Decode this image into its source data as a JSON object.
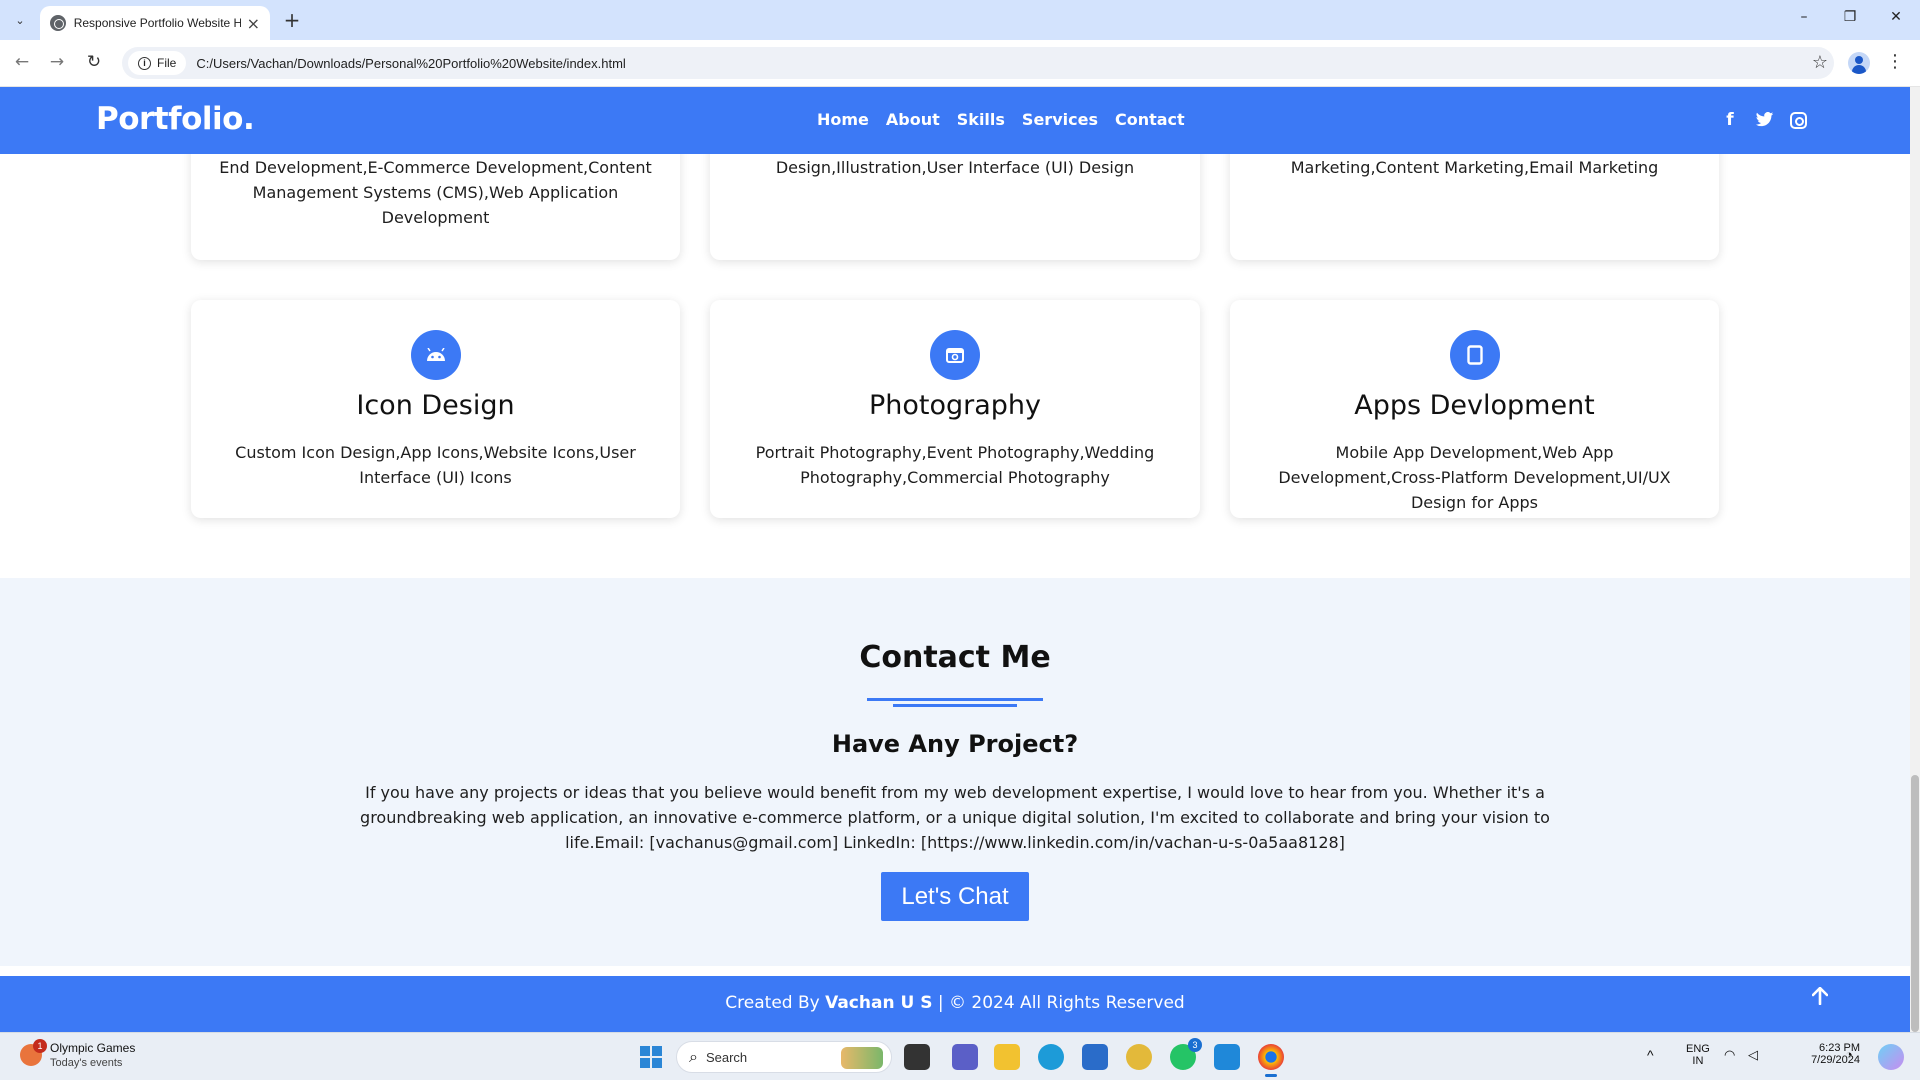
{
  "browser": {
    "tab_title": "Responsive Portfolio Website H",
    "file_label": "File",
    "url": "C:/Users/Vachan/Downloads/Personal%20Portfolio%20Website/index.html"
  },
  "site": {
    "logo": "Portfolio.",
    "nav": [
      "Home",
      "About",
      "Skills",
      "Services",
      "Contact"
    ],
    "social_icons": [
      "facebook-icon",
      "twitter-icon",
      "instagram-icon"
    ]
  },
  "services": {
    "top_row": [
      {
        "desc": "End Development,E-Commerce Development,Content Management Systems (CMS),Web Application Development"
      },
      {
        "desc": "Design,Illustration,User Interface (UI) Design"
      },
      {
        "desc": "Marketing,Content Marketing,Email Marketing"
      }
    ],
    "bottom_row": [
      {
        "icon": "android-icon",
        "title": "Icon Design",
        "desc": "Custom Icon Design,App Icons,Website Icons,User Interface (UI) Icons"
      },
      {
        "icon": "camera-icon",
        "title": "Photography",
        "desc": "Portrait Photography,Event Photography,Wedding Photography,Commercial Photography"
      },
      {
        "icon": "tablet-icon",
        "title": "Apps Devlopment",
        "desc": "Mobile App Development,Web App Development,Cross-Platform Development,UI/UX Design for Apps"
      }
    ]
  },
  "contact": {
    "title": "Contact Me",
    "subtitle": "Have Any Project?",
    "text": "If you have any projects or ideas that you believe would benefit from my web development expertise, I would love to hear from you. Whether it's a groundbreaking web application, an innovative e-commerce platform, or a unique digital solution, I'm excited to collaborate and bring your vision to life.Email: [vachanus@gmail.com] LinkedIn: [https://www.linkedin.com/in/vachan-u-s-0a5aa8128]",
    "button": "Let's Chat"
  },
  "footer": {
    "prefix": "Created By ",
    "author": "Vachan U S",
    "suffix": " | © 2024 All Rights Reserved"
  },
  "taskbar": {
    "weather_title": "Olympic Games",
    "weather_sub": "Today's events",
    "weather_badge": "1",
    "search_label": "Search",
    "whatsapp_badge": "3",
    "lang_top": "ENG",
    "lang_bottom": "IN",
    "time": "6:23 PM",
    "date": "7/29/2024"
  },
  "colors": {
    "accent": "#3c79f5",
    "contact_bg": "#f0f5fc",
    "tabbar_bg": "#d3e3fd"
  }
}
